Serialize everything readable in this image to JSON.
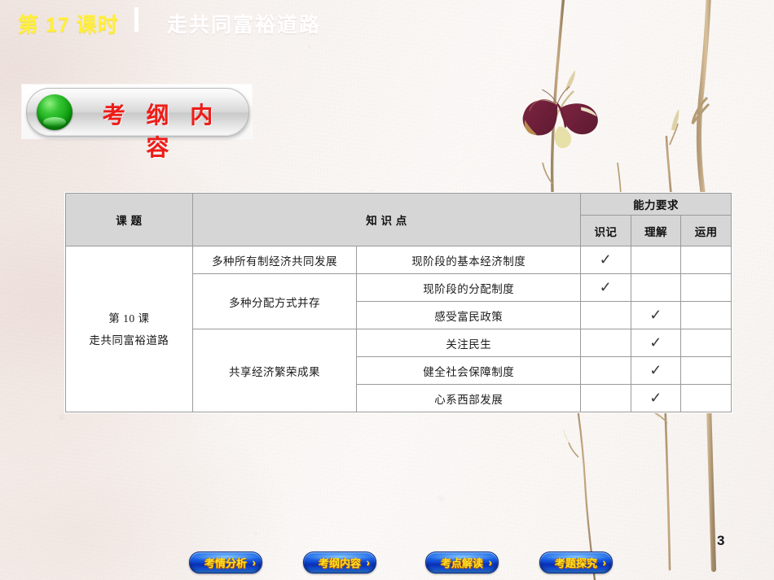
{
  "title": {
    "lesson_number": "第 17 课时",
    "separator": "|",
    "lesson_name": "走共同富裕道路"
  },
  "section_badge": {
    "label": "考 纲 内 容"
  },
  "table": {
    "headers": {
      "topic": "课  题",
      "knowledge": "知  识  点",
      "ability": "能力要求",
      "ability_sub": [
        "识记",
        "理解",
        "运用"
      ]
    },
    "topic_cell": {
      "line1": "第 10 课",
      "line2": "走共同富裕道路"
    },
    "units": [
      {
        "name": "多种所有制经济共同发展",
        "span": 1
      },
      {
        "name": "多种分配方式并存",
        "span": 2
      },
      {
        "name": "共享经济繁荣成果",
        "span": 3
      }
    ],
    "rows": [
      {
        "point": "现阶段的基本经济制度",
        "marks": [
          "✓",
          "",
          ""
        ]
      },
      {
        "point": "现阶段的分配制度",
        "marks": [
          "✓",
          "",
          ""
        ]
      },
      {
        "point": "感受富民政策",
        "marks": [
          "",
          "✓",
          ""
        ]
      },
      {
        "point": "关注民生",
        "marks": [
          "",
          "✓",
          ""
        ]
      },
      {
        "point": "健全社会保障制度",
        "marks": [
          "",
          "✓",
          ""
        ]
      },
      {
        "point": "心系西部发展",
        "marks": [
          "",
          "✓",
          ""
        ]
      }
    ]
  },
  "footer_nav": [
    {
      "label": "考情分析",
      "arrow": "›"
    },
    {
      "label": "考纲内容",
      "arrow": "›"
    },
    {
      "label": "考点解读",
      "arrow": "›"
    },
    {
      "label": "考题探究",
      "arrow": "›"
    }
  ],
  "page_number": "3",
  "colors": {
    "title_number": "#FFEF3A",
    "title_name": "#FFFFFF",
    "badge_text": "#EE1C18",
    "badge_dot": "#10A012",
    "nav_button": "#1050DD",
    "nav_label": "#FFE224",
    "table_header_bg": "#D6D6D6"
  }
}
